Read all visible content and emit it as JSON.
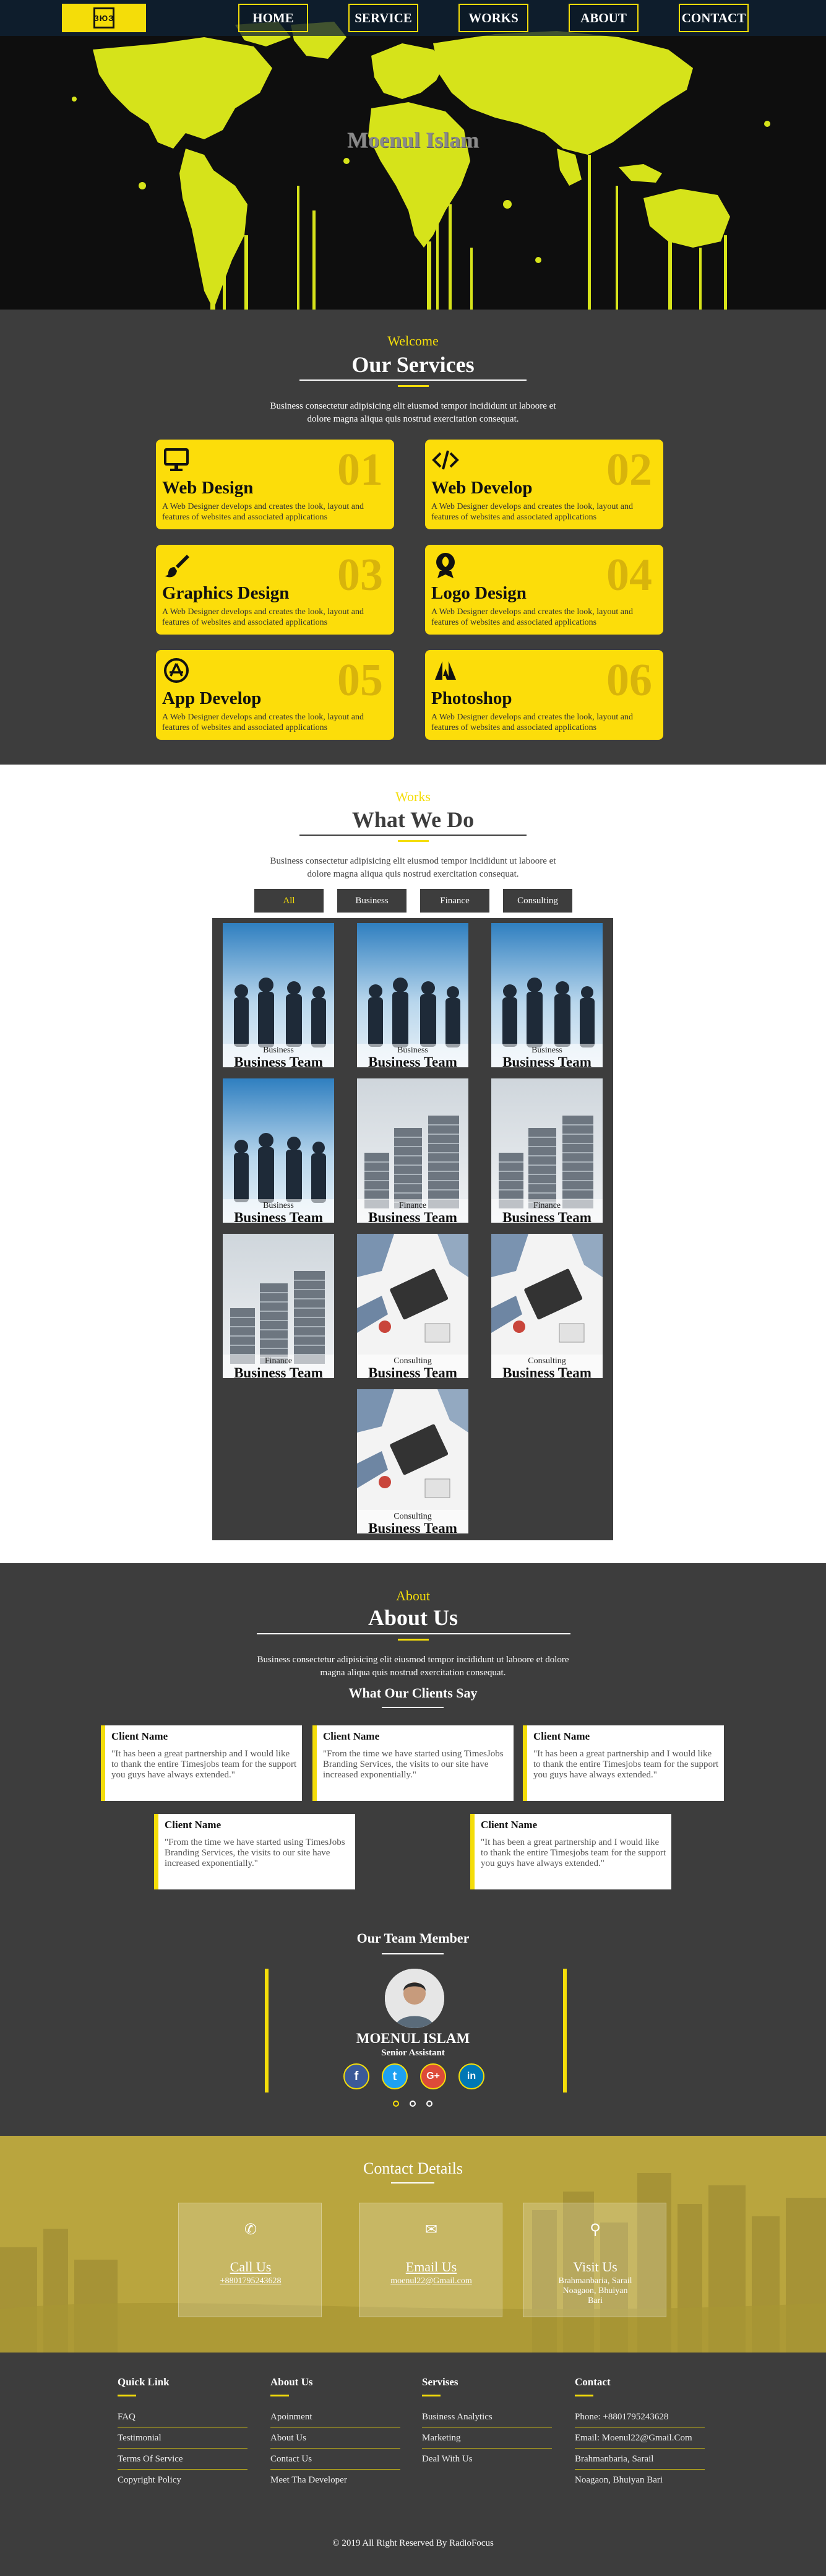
{
  "nav": {
    "logo_text": "ЗЮЗ",
    "items": [
      "HOME",
      "SERVICE",
      "WORKS",
      "ABOUT",
      "CONTACT"
    ]
  },
  "hero": {
    "title": "Moenul Islam"
  },
  "services": {
    "kicker": "Welcome",
    "title": "Our Services",
    "description": "Business consectetur adipisicing elit eiusmod tempor incididunt ut laboore et dolore magna aliqua quis nostrud exercitation consequat.",
    "cards": [
      {
        "icon": "monitor-icon",
        "number": "01",
        "title": "Web Design",
        "text": "A Web Designer develops and creates the look, layout and features of websites and associated applications"
      },
      {
        "icon": "code-icon",
        "number": "02",
        "title": "Web Develop",
        "text": "A Web Designer develops and creates the look, layout and features of websites and associated applications"
      },
      {
        "icon": "paint-brush-icon",
        "number": "03",
        "title": "Graphics Design",
        "text": "A Web Designer develops and creates the look, layout and features of websites and associated applications"
      },
      {
        "icon": "leaf-badge-icon",
        "number": "04",
        "title": "Logo Design",
        "text": "A Web Designer develops and creates the look, layout and features of websites and associated applications"
      },
      {
        "icon": "app-store-icon",
        "number": "05",
        "title": "App Develop",
        "text": "A Web Designer develops and creates the look, layout and features of websites and associated applications"
      },
      {
        "icon": "adobe-icon",
        "number": "06",
        "title": "Photoshop",
        "text": "A Web Designer develops and creates the look, layout and features of websites and associated applications"
      }
    ]
  },
  "works": {
    "kicker": "Works",
    "title": "What We Do",
    "description": "Business consectetur adipisicing elit eiusmod tempor incididunt ut laboore et dolore magna aliqua quis nostrud exercitation consequat.",
    "filters": [
      "All",
      "Business",
      "Finance",
      "Consulting"
    ],
    "active_filter": "All",
    "items": [
      {
        "category": "Business",
        "name": "Business Team",
        "image": "business-people"
      },
      {
        "category": "Business",
        "name": "Business Team",
        "image": "business-people"
      },
      {
        "category": "Business",
        "name": "Business Team",
        "image": "business-people"
      },
      {
        "category": "Business",
        "name": "Business Team",
        "image": "business-people"
      },
      {
        "category": "Finance",
        "name": "Business Team",
        "image": "coins"
      },
      {
        "category": "Finance",
        "name": "Business Team",
        "image": "coins"
      },
      {
        "category": "Finance",
        "name": "Business Team",
        "image": "coins"
      },
      {
        "category": "Consulting",
        "name": "Business Team",
        "image": "laptop-desk"
      },
      {
        "category": "Consulting",
        "name": "Business Team",
        "image": "laptop-desk"
      },
      {
        "category": "Consulting",
        "name": "Business Team",
        "image": "laptop-desk"
      }
    ]
  },
  "about": {
    "kicker": "About",
    "title": "About Us",
    "description": "Business consectetur adipisicing elit eiusmod tempor incididunt ut laboore et dolore magna aliqua quis nostrud exercitation consequat.",
    "clients_title": "What Our Clients Say",
    "testimonials": [
      {
        "name": "Client Name",
        "text": "\"It has been a great partnership and I would like to thank the entire Timesjobs team for the support you guys have always extended.\""
      },
      {
        "name": "Client Name",
        "text": "\"From the time we have started using TimesJobs Branding Services, the visits to our site have increased exponentially.\""
      },
      {
        "name": "Client Name",
        "text": "\"It has been a great partnership and I would like to thank the entire Timesjobs team for the support you guys have always extended.\""
      },
      {
        "name": "Client Name",
        "text": "\"From the time we have started using TimesJobs Branding Services, the visits to our site have increased exponentially.\""
      },
      {
        "name": "Client Name",
        "text": "\"It has been a great partnership and I would like to thank the entire Timesjobs team for the support you guys have always extended.\""
      }
    ],
    "team_title": "Our Team Member",
    "member": {
      "name": "MOENUL ISLAM",
      "role": "Senior Assistant"
    },
    "social": [
      {
        "icon": "facebook-icon",
        "glyph": "f",
        "color": "#3b5998"
      },
      {
        "icon": "twitter-icon",
        "glyph": "t",
        "color": "#1da1f2"
      },
      {
        "icon": "google-plus-icon",
        "glyph": "G+",
        "color": "#dd4b39"
      },
      {
        "icon": "linkedin-icon",
        "glyph": "in",
        "color": "#0077b5"
      }
    ],
    "carousel_active": 1
  },
  "contact": {
    "title": "Contact Details",
    "boxes": [
      {
        "icon": "phone-icon",
        "glyph": "✆",
        "title": "Call Us",
        "value": "+8801795243628"
      },
      {
        "icon": "envelope-icon",
        "glyph": "✉",
        "title": "Email Us",
        "value": "moenul22@Gmail.com"
      },
      {
        "icon": "location-pin-icon",
        "glyph": "⚲",
        "title": "Visit Us",
        "value": "Brahmanbaria, Sarail Noagaon, Bhuiyan Bari"
      }
    ]
  },
  "footer": {
    "columns": [
      {
        "heading": "Quick Link",
        "links": [
          "FAQ",
          "Testimonial",
          "Terms Of Service",
          "Copyright Policy"
        ]
      },
      {
        "heading": "About Us",
        "links": [
          "Apoinment",
          "About Us",
          "Contact Us",
          "Meet Tha Developer"
        ]
      },
      {
        "heading": "Servises",
        "links": [
          "Business Analytics",
          "Marketing",
          "Deal With Us"
        ]
      },
      {
        "heading": "Contact",
        "links": [
          "Phone: +8801795243628",
          "Email: Moenul22@Gmail.Com",
          "Brahmanbaria, Sarail",
          "Noagaon, Bhuiyan Bari"
        ]
      }
    ],
    "copyright": "© 2019 All Right Reserved By RadioFocus"
  },
  "colors": {
    "accent": "#f4dd09",
    "dark": "#3d3d3d",
    "card": "#fcdd0a"
  }
}
